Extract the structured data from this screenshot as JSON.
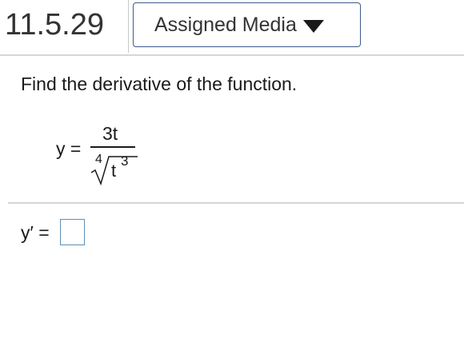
{
  "header": {
    "problem_number": "11.5.29",
    "media_button_label": "Assigned Media",
    "media_button_icon": "caret-down-icon"
  },
  "question": {
    "instruction": "Find the derivative of the function.",
    "lhs": "y =",
    "numerator": "3t",
    "root_index": "4",
    "radicand_base": "t",
    "radicand_exponent": "3"
  },
  "answer": {
    "label": "y′ =",
    "value": ""
  },
  "colors": {
    "button_border": "#3d5a8c",
    "answer_box_border": "#5d8fb8",
    "divider": "#d6d6d6"
  }
}
